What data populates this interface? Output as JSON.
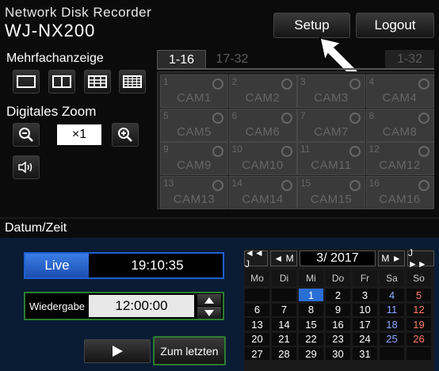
{
  "header": {
    "subtitle": "Network Disk Recorder",
    "model": "WJ-NX200",
    "setup_label": "Setup",
    "logout_label": "Logout"
  },
  "multiview": {
    "label": "Mehrfachanzeige",
    "layouts": [
      "1-screen-layout-icon",
      "4-screen-layout-icon",
      "9-screen-layout-icon",
      "16-screen-layout-icon"
    ]
  },
  "zoom": {
    "label": "Digitales Zoom",
    "value": "×1"
  },
  "tabs": [
    {
      "label": "1-16",
      "active": true
    },
    {
      "label": "17-32",
      "active": false
    }
  ],
  "tab_right": "1-32",
  "cameras": [
    {
      "num": "1",
      "name": "CAM1"
    },
    {
      "num": "2",
      "name": "CAM2"
    },
    {
      "num": "3",
      "name": "CAM3"
    },
    {
      "num": "4",
      "name": "CAM4"
    },
    {
      "num": "5",
      "name": "CAM5"
    },
    {
      "num": "6",
      "name": "CAM6"
    },
    {
      "num": "7",
      "name": "CAM7"
    },
    {
      "num": "8",
      "name": "CAM8"
    },
    {
      "num": "9",
      "name": "CAM9"
    },
    {
      "num": "10",
      "name": "CAM10"
    },
    {
      "num": "11",
      "name": "CAM11"
    },
    {
      "num": "12",
      "name": "CAM12"
    },
    {
      "num": "13",
      "name": "CAM13"
    },
    {
      "num": "14",
      "name": "CAM14"
    },
    {
      "num": "15",
      "name": "CAM15"
    },
    {
      "num": "16",
      "name": "CAM16"
    }
  ],
  "datetime": {
    "section_label": "Datum/Zeit",
    "live_label": "Live",
    "live_time": "19:10:35",
    "playback_label": "Wiedergabe",
    "playback_time": "12:00:00",
    "play_icon": "play-icon",
    "to_latest_label": "Zum letzten"
  },
  "calendar": {
    "year_prev": "◄◄ J",
    "month_prev": "◄ M",
    "month_year": "3/ 2017",
    "month_next": "M ►",
    "year_next": "J ►►",
    "day_headers": [
      "Mo",
      "Di",
      "Mi",
      "Do",
      "Fr",
      "Sa",
      "So"
    ],
    "weeks": [
      [
        "",
        "",
        "1",
        "2",
        "3",
        "4",
        "5"
      ],
      [
        "6",
        "7",
        "8",
        "9",
        "10",
        "11",
        "12"
      ],
      [
        "13",
        "14",
        "15",
        "16",
        "17",
        "18",
        "19"
      ],
      [
        "20",
        "21",
        "22",
        "23",
        "24",
        "25",
        "26"
      ],
      [
        "27",
        "28",
        "29",
        "30",
        "31",
        "",
        ""
      ]
    ],
    "selected_day": "1",
    "colors": {
      "saturday": "#8fa8ff",
      "sunday": "#ff7b6b",
      "selected": "#2a6fd6",
      "accent_blue": "#1f5fd0",
      "playback_border": "#2e7d32"
    }
  }
}
